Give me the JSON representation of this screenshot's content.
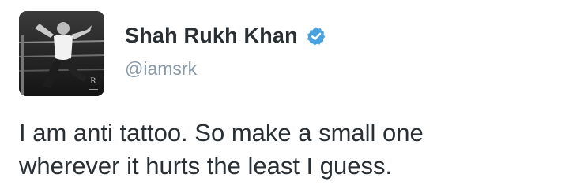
{
  "author": {
    "display_name": "Shah Rukh Khan",
    "handle": "@iamsrk",
    "verified": true,
    "verified_badge_color": "#4aa3df",
    "avatar_icon": "profile-photo"
  },
  "tweet": {
    "lines": [
      "I am anti tattoo. So make a small one",
      "wherever it hurts the least I guess."
    ]
  },
  "colors": {
    "name": "#292f33",
    "handle": "#8899a6",
    "text": "#292f33",
    "background": "#ffffff"
  }
}
